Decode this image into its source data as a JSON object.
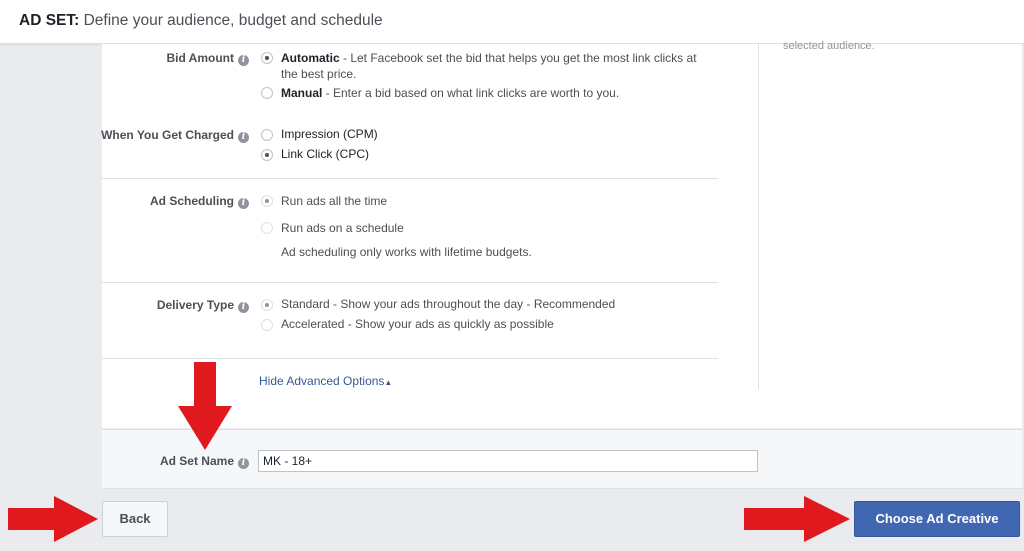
{
  "header": {
    "title_strong": "AD SET:",
    "title_rest": " Define your audience, budget and schedule"
  },
  "sidebar_note": "selected audience.",
  "bid_amount": {
    "label": "Bid Amount",
    "options": [
      {
        "title": "Automatic",
        "desc": " - Let Facebook set the bid that helps you get the most link clicks at",
        "desc2": "the best price.",
        "selected": true
      },
      {
        "title": "Manual",
        "desc": " - Enter a bid based on what link clicks are worth to you.",
        "selected": false
      }
    ]
  },
  "charged": {
    "label": "When You Get Charged",
    "options": [
      {
        "title": "Impression (CPM)",
        "selected": false
      },
      {
        "title": "Link Click (CPC)",
        "selected": true
      }
    ]
  },
  "scheduling": {
    "label": "Ad Scheduling",
    "options": [
      {
        "title": "Run ads all the time",
        "selected": true
      },
      {
        "title": "Run ads on a schedule",
        "selected": false
      }
    ],
    "note": "Ad scheduling only works with lifetime budgets."
  },
  "delivery": {
    "label": "Delivery Type",
    "options": [
      {
        "title": "Standard",
        "desc": " - Show your ads throughout the day - Recommended",
        "selected": true
      },
      {
        "title": "Accelerated",
        "desc": " - Show your ads as quickly as possible",
        "selected": false
      }
    ]
  },
  "advanced_link": "Hide Advanced Options",
  "ad_set_name": {
    "label": "Ad Set Name",
    "value": "MK - 18+"
  },
  "footer": {
    "back_label": "Back",
    "next_label": "Choose Ad Creative"
  },
  "icons": {
    "info": "info-icon",
    "arrow": "red-arrow",
    "caret": "caret-up-icon"
  },
  "colors": {
    "primary": "#4267b2",
    "arrow": "#e0191f",
    "link": "#365899"
  }
}
